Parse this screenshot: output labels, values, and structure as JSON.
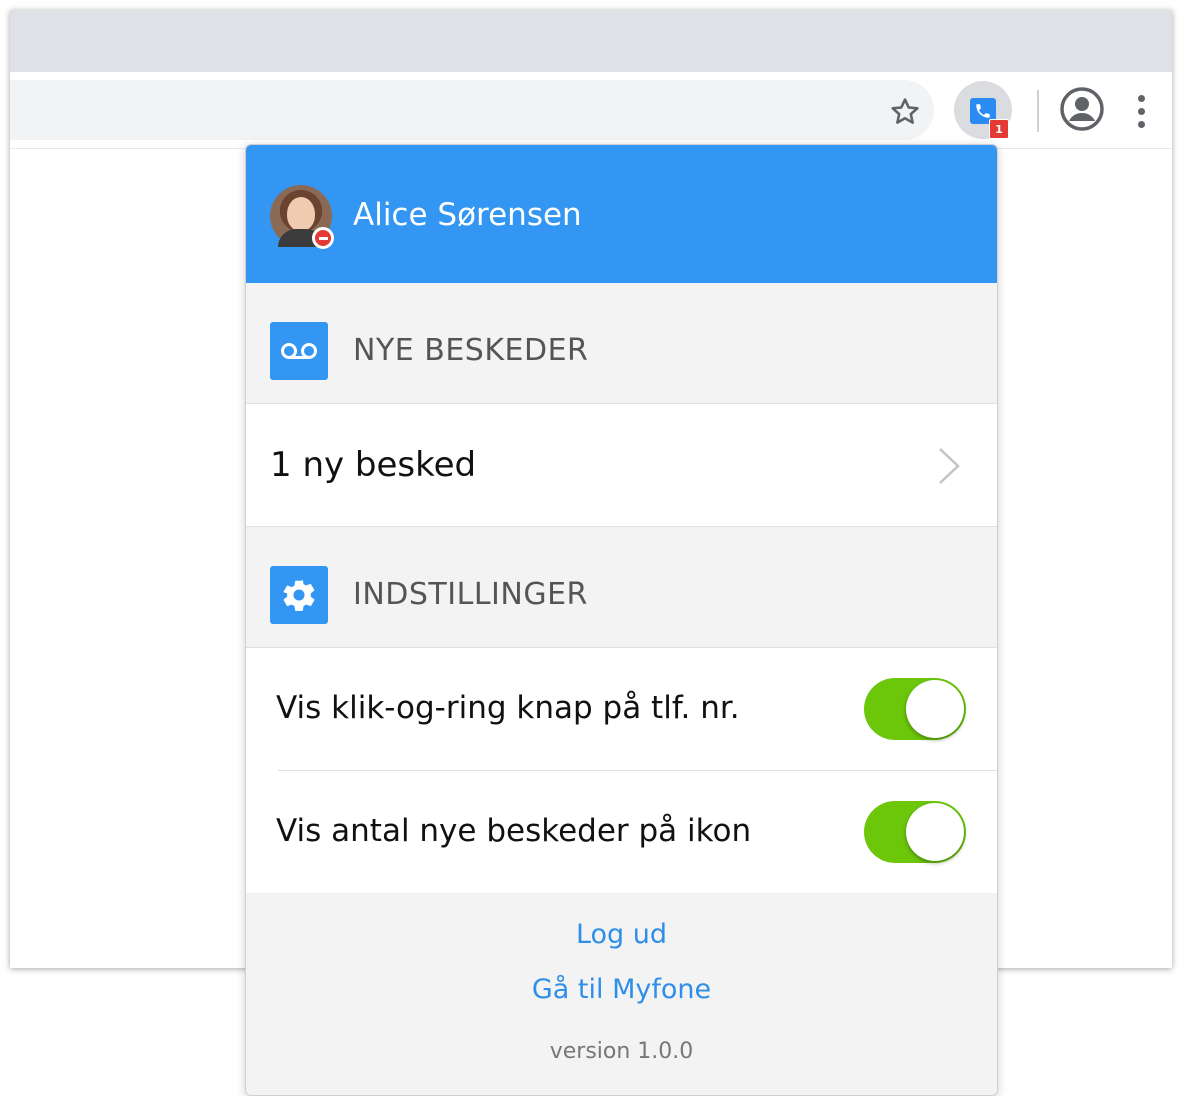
{
  "browser": {
    "extension_badge": "1"
  },
  "popup": {
    "user_name": "Alice Sørensen",
    "messages_section": {
      "title": "NYE BESKEDER",
      "item_label": "1 ny besked"
    },
    "settings_section": {
      "title": "INDSTILLINGER",
      "items": [
        {
          "label": "Vis klik-og-ring knap på tlf. nr.",
          "enabled": true
        },
        {
          "label": "Vis antal nye beskeder på ikon",
          "enabled": true
        }
      ]
    },
    "footer": {
      "logout": "Log ud",
      "goto_myfone": "Gå til Myfone",
      "version": "version 1.0.0"
    }
  },
  "colors": {
    "header_blue": "#3396f3",
    "toggle_green": "#6cc70b",
    "link_blue": "#2f8fe8",
    "presence_red": "#e53935"
  }
}
